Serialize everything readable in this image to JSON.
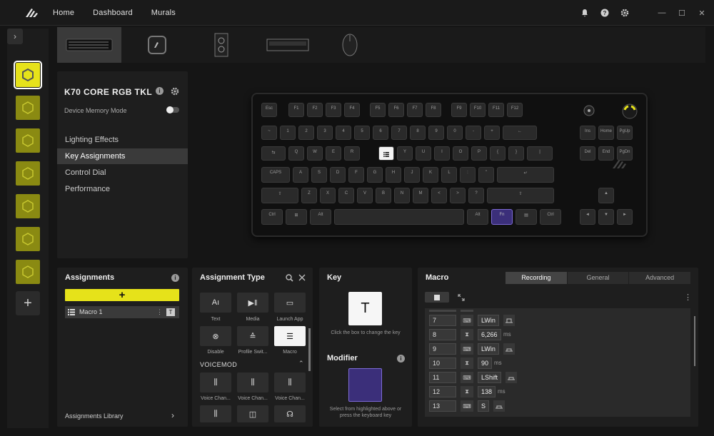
{
  "nav": {
    "home": "Home",
    "dashboard": "Dashboard",
    "murals": "Murals"
  },
  "device": {
    "title": "K70 CORE RGB TKL",
    "memory_mode": "Device Memory Mode",
    "menu": [
      "Lighting Effects",
      "Key Assignments",
      "Control Dial",
      "Performance"
    ]
  },
  "assignments": {
    "title": "Assignments",
    "add_label": "+",
    "macro_name": "Macro 1",
    "macro_key": "T",
    "library": "Assignments Library",
    "library_arrow": "›"
  },
  "assignment_type": {
    "title": "Assignment Type",
    "tiles": [
      {
        "label": "Text",
        "glyph": "Aı"
      },
      {
        "label": "Media",
        "glyph": "▶‖"
      },
      {
        "label": "Launch App",
        "glyph": "▭"
      },
      {
        "label": "Disable",
        "glyph": "⊗"
      },
      {
        "label": "Profile Swit...",
        "glyph": "≙"
      },
      {
        "label": "Macro",
        "glyph": "☰"
      }
    ],
    "voicemod": "VOICEMOD",
    "voice_tiles": [
      "Voice Chan...",
      "Voice Chan...",
      "Voice Chan..."
    ]
  },
  "key_panel": {
    "title": "Key",
    "key": "T",
    "hint": "Click the box to change the key",
    "modifier_title": "Modifier",
    "modifier_hint_1": "Select from highlighted above or",
    "modifier_hint_2": "press the keyboard key"
  },
  "macro": {
    "title": "Macro",
    "tabs": [
      "Recording",
      "General",
      "Advanced"
    ],
    "active_tab": "Recording",
    "events": [
      {
        "n": "7",
        "type": "key",
        "value": "LWin",
        "unit": "",
        "action": "up"
      },
      {
        "n": "8",
        "type": "delay",
        "value": "6,266",
        "unit": "ms",
        "action": ""
      },
      {
        "n": "9",
        "type": "key",
        "value": "LWin",
        "unit": "",
        "action": "down"
      },
      {
        "n": "10",
        "type": "delay",
        "value": "90",
        "unit": "ms",
        "action": ""
      },
      {
        "n": "11",
        "type": "key",
        "value": "LShift",
        "unit": "",
        "action": "down"
      },
      {
        "n": "12",
        "type": "delay",
        "value": "138",
        "unit": "ms",
        "action": ""
      },
      {
        "n": "13",
        "type": "key",
        "value": "S",
        "unit": "",
        "action": "down"
      }
    ]
  },
  "keyboard": {
    "rows": [
      [
        "Esc",
        "F1",
        "F2",
        "F3",
        "F4",
        "F5",
        "F6",
        "F7",
        "F8",
        "F9",
        "F10",
        "F11",
        "F12"
      ],
      [
        "~",
        "1",
        "2",
        "3",
        "4",
        "5",
        "6",
        "7",
        "8",
        "9",
        "0",
        "-",
        "+",
        "←",
        "Ins",
        "Home",
        "PgUp"
      ],
      [
        "⇆",
        "Q",
        "W",
        "E",
        "R",
        "",
        "Y",
        "U",
        "I",
        "O",
        "P",
        "{",
        "}",
        "|",
        "Del",
        "End",
        "PgDn"
      ],
      [
        "CAPS",
        "A",
        "S",
        "D",
        "F",
        "G",
        "H",
        "J",
        "K",
        "L",
        ":",
        "\"",
        "↵"
      ],
      [
        "⇧",
        "Z",
        "X",
        "C",
        "V",
        "B",
        "N",
        "M",
        "<",
        ">",
        "?",
        "⇧",
        "▲"
      ],
      [
        "Ctrl",
        "⊞",
        "Alt",
        "",
        "Alt",
        "Fn",
        "▤",
        "Ctrl",
        "◄",
        "▼",
        "►"
      ]
    ]
  },
  "colors": {
    "accent": "#e6e21a",
    "modifier": "#3b2f7a"
  },
  "icons": [
    "corsair-logo-icon",
    "bell-icon",
    "help-icon",
    "gear-icon",
    "minimize-icon",
    "maximize-icon",
    "close-icon"
  ]
}
